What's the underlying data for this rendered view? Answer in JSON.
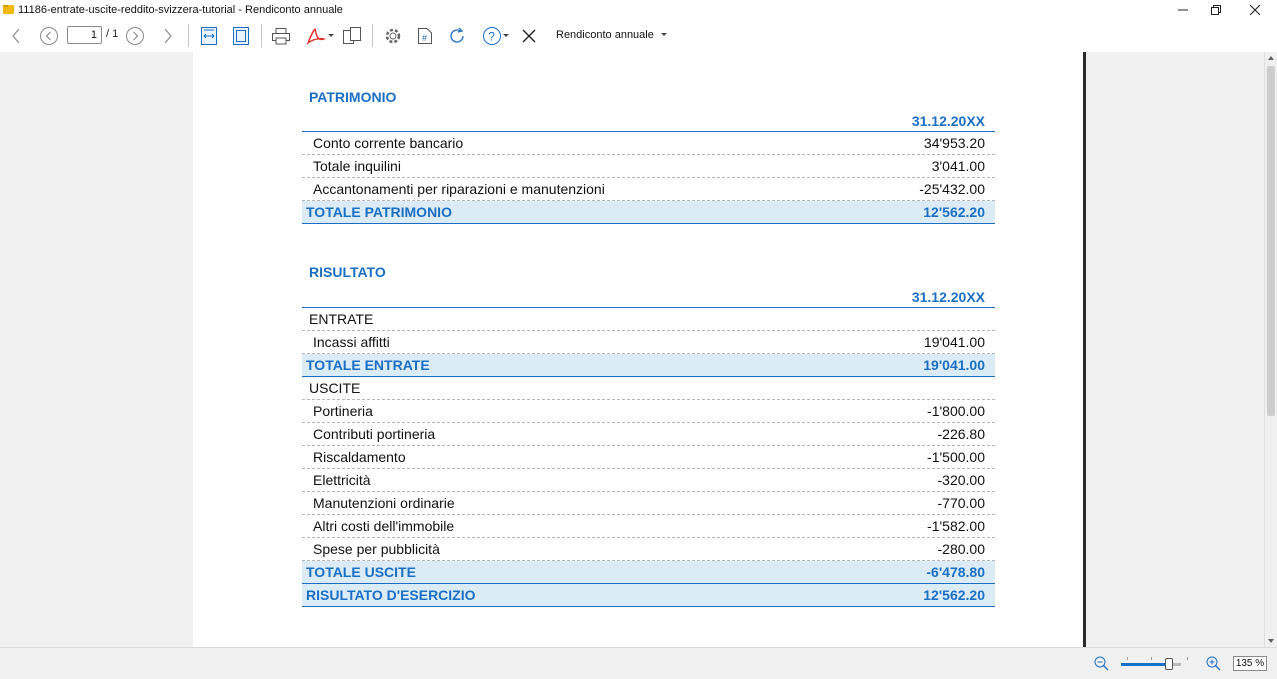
{
  "window": {
    "title": "11186-entrate-uscite-reddito-svizzera-tutorial - Rendiconto annuale"
  },
  "toolbar": {
    "page_current": "1",
    "page_total": "/ 1",
    "view_selector": "Rendiconto annuale"
  },
  "report": {
    "patrimonio": {
      "title": "PATRIMONIO",
      "date": "31.12.20XX",
      "rows": [
        {
          "label": "Conto corrente bancario",
          "value": "34'953.20"
        },
        {
          "label": "Totale inquilini",
          "value": "3'041.00"
        },
        {
          "label": "Accantonamenti per riparazioni e manutenzioni",
          "value": "-25'432.00"
        }
      ],
      "total": {
        "label": "TOTALE PATRIMONIO",
        "value": "12'562.20"
      }
    },
    "risultato": {
      "title": "RISULTATO",
      "date": "31.12.20XX",
      "entrate_label": "ENTRATE",
      "entrate_rows": [
        {
          "label": "Incassi affitti",
          "value": "19'041.00"
        }
      ],
      "entrate_total": {
        "label": "TOTALE ENTRATE",
        "value": "19'041.00"
      },
      "uscite_label": "USCITE",
      "uscite_rows": [
        {
          "label": "Portineria",
          "value": "-1'800.00"
        },
        {
          "label": "Contributi portineria",
          "value": "-226.80"
        },
        {
          "label": "Riscaldamento",
          "value": "-1'500.00"
        },
        {
          "label": "Elettricità",
          "value": "-320.00"
        },
        {
          "label": "Manutenzioni ordinarie",
          "value": "-770.00"
        },
        {
          "label": "Altri costi dell'immobile",
          "value": "-1'582.00"
        },
        {
          "label": "Spese per pubblicità",
          "value": "-280.00"
        }
      ],
      "uscite_total": {
        "label": "TOTALE USCITE",
        "value": "-6'478.80"
      },
      "result_total": {
        "label": "RISULTATO D'ESERCIZIO",
        "value": "12'562.20"
      }
    }
  },
  "statusbar": {
    "zoom_value": "135 %",
    "zoom_level": 0.75
  },
  "colors": {
    "accent": "#1a6fc4",
    "total_bg": "#dcecf7"
  }
}
